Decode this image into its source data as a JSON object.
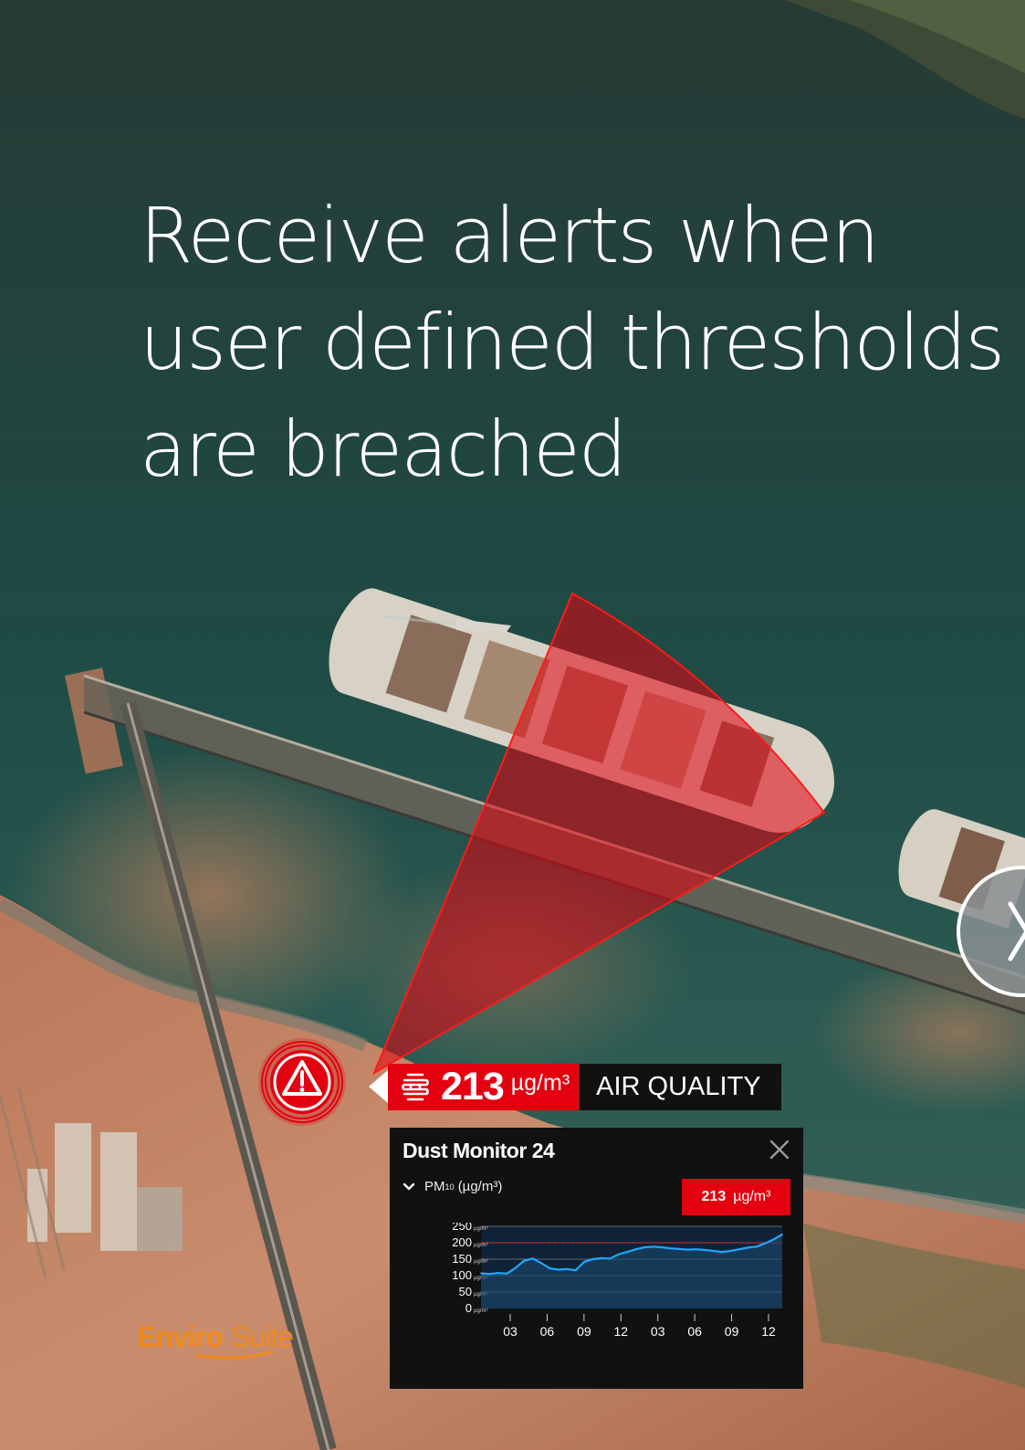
{
  "headline": {
    "lines": [
      "Receive alerts when",
      "user defined thresholds",
      "are breached"
    ]
  },
  "brand": {
    "logo_text": "EnviroSuite",
    "logo_parts": [
      "Enviro",
      "Suite"
    ],
    "accent_color": "#e3000f",
    "logo_color": "#f08a1c"
  },
  "alert": {
    "marker_icon": "warning-triangle-icon",
    "value": "213",
    "unit": "µg/m³",
    "category": "AIR QUALITY",
    "sensor_icon": "dust-icon"
  },
  "monitor_panel": {
    "title": "Dust Monitor 24",
    "metric": {
      "name": "PM",
      "subscript": "10",
      "unit_label": "(µg/m³)"
    },
    "current_value": "213",
    "current_unit": "µg/m³"
  },
  "chart_data": {
    "type": "area",
    "ylim": [
      0,
      250
    ],
    "y_ticks": [
      250,
      200,
      150,
      100,
      50,
      0
    ],
    "y_tick_unit": "µg/m³",
    "x_ticks": [
      "03",
      "06",
      "09",
      "12",
      "03",
      "06",
      "09",
      "12"
    ],
    "threshold": 200,
    "grid": true,
    "series": [
      {
        "color": "#1ea7ff",
        "values": [
          107,
          105,
          108,
          106,
          123,
          145,
          152,
          138,
          122,
          118,
          120,
          116,
          142,
          150,
          153,
          152,
          165,
          172,
          180,
          186,
          188,
          186,
          183,
          181,
          179,
          180,
          178,
          175,
          172,
          175,
          180,
          185,
          188,
          198,
          210,
          225
        ]
      }
    ]
  }
}
